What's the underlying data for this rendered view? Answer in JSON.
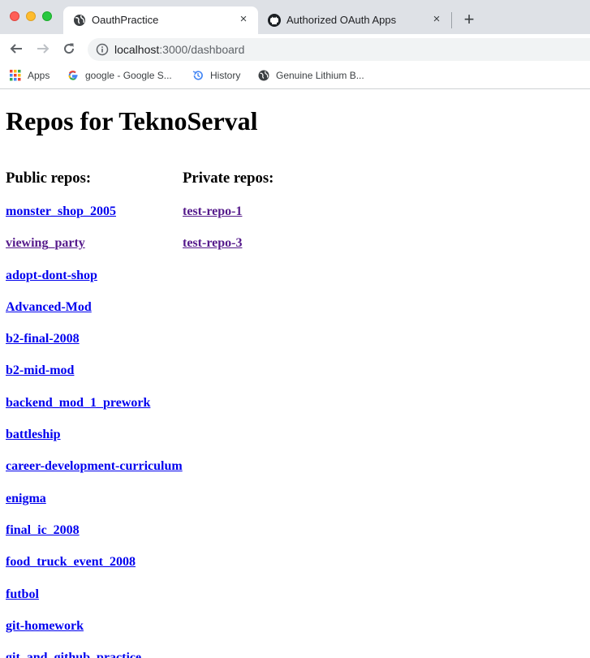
{
  "browser": {
    "tabs": [
      {
        "title": "OauthPractice",
        "icon": "globe-icon",
        "active": true
      },
      {
        "title": "Authorized OAuth Apps",
        "icon": "github-icon",
        "active": false
      }
    ],
    "close_glyph": "×",
    "new_tab_glyph": "+",
    "url_host": "localhost",
    "url_path": ":3000/dashboard",
    "bookmarks": [
      {
        "label": "Apps",
        "icon": "apps-grid-icon"
      },
      {
        "label": "google - Google S...",
        "icon": "google-icon"
      },
      {
        "label": "History",
        "icon": "history-icon"
      },
      {
        "label": "Genuine Lithium B...",
        "icon": "globe-icon"
      }
    ]
  },
  "page": {
    "heading": "Repos for TeknoServal",
    "public_heading": "Public repos:",
    "private_heading": "Private repos:",
    "public_repos": [
      {
        "name": "monster_shop_2005",
        "visited": false
      },
      {
        "name": "viewing_party",
        "visited": true
      },
      {
        "name": "adopt-dont-shop",
        "visited": false
      },
      {
        "name": "Advanced-Mod",
        "visited": false
      },
      {
        "name": "b2-final-2008",
        "visited": false
      },
      {
        "name": "b2-mid-mod",
        "visited": false
      },
      {
        "name": "backend_mod_1_prework",
        "visited": false
      },
      {
        "name": "battleship",
        "visited": false
      },
      {
        "name": "career-development-curriculum",
        "visited": false
      },
      {
        "name": "enigma",
        "visited": false
      },
      {
        "name": "final_ic_2008",
        "visited": false
      },
      {
        "name": "food_truck_event_2008",
        "visited": false
      },
      {
        "name": "futbol",
        "visited": false
      },
      {
        "name": "git-homework",
        "visited": false
      },
      {
        "name": "git_and_github_practice",
        "visited": false
      }
    ],
    "private_repos": [
      {
        "name": "test-repo-1",
        "visited": true
      },
      {
        "name": "test-repo-3",
        "visited": true
      }
    ]
  },
  "colors": {
    "link": "#0000ee",
    "visited_link": "#551a8b",
    "tabstrip_bg": "#dee1e6"
  }
}
